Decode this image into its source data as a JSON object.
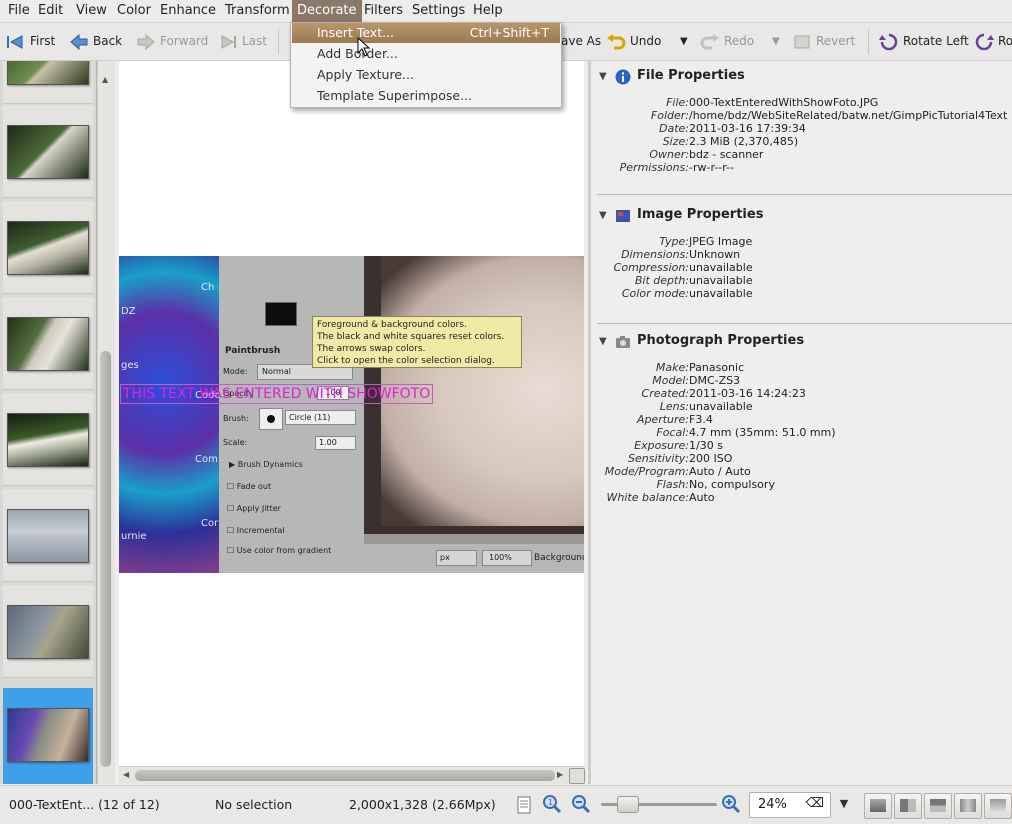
{
  "menubar": {
    "items": [
      "File",
      "Edit",
      "View",
      "Color",
      "Enhance",
      "Transform",
      "Decorate",
      "Filters",
      "Settings",
      "Help"
    ],
    "active": "Decorate"
  },
  "toolbar": {
    "first": "First",
    "back": "Back",
    "forward": "Forward",
    "last": "Last",
    "save_as": "ave As",
    "undo": "Undo",
    "redo": "Redo",
    "revert": "Revert",
    "rotate_left": "Rotate Left",
    "rotate_right": "Ro"
  },
  "decorate_menu": {
    "items": [
      {
        "label": "Insert Text...",
        "shortcut": "Ctrl+Shift+T"
      },
      {
        "label": "Add Border...",
        "shortcut": ""
      },
      {
        "label": "Apply Texture...",
        "shortcut": ""
      },
      {
        "label": "Template Superimpose...",
        "shortcut": ""
      }
    ]
  },
  "thumbnails": {
    "count": 8,
    "selected_index": 7
  },
  "photo": {
    "overlay_text": "THIS TEXT WAS ENTERED WITH SHOWFOTO",
    "tooltip_lines": [
      "Foreground & background colors.",
      "The black and white squares reset colors.",
      "The arrows swap colors.",
      "Click to open the color selection dialog."
    ],
    "panel_title": "Paintbrush",
    "mode_label": "Mode:",
    "mode_value": "Normal",
    "opacity_label": "Opacity",
    "opacity_value": "100",
    "brush_label": "Brush:",
    "brush_value": "Circle (11)",
    "scale_label": "Scale:",
    "scale_value": "1.00",
    "brush_dynamics": "Brush Dynamics",
    "fade_out": "Fade out",
    "apply_jitter": "Apply Jitter",
    "incremental": "Incremental",
    "use_color": "Use color from gradient",
    "unit": "px",
    "zoom": "100%",
    "background": "Background",
    "left_texts": [
      "Ch",
      "DZ",
      "ges",
      "Code",
      "Com",
      "Cor",
      "urnie"
    ]
  },
  "properties": {
    "file": {
      "title": "File Properties",
      "rows": [
        {
          "k": "File:",
          "v": "000-TextEnteredWithShowFoto.JPG"
        },
        {
          "k": "Folder:",
          "v": "/home/bdz/WebSiteRelated/batw.net/GimpPicTutorial4Text"
        },
        {
          "k": "Date:",
          "v": "2011-03-16 17:39:34"
        },
        {
          "k": "Size:",
          "v": "2.3 MiB (2,370,485)"
        },
        {
          "k": "Owner:",
          "v": "bdz - scanner"
        },
        {
          "k": "Permissions:",
          "v": "-rw-r--r--"
        }
      ]
    },
    "image": {
      "title": "Image Properties",
      "rows": [
        {
          "k": "Type:",
          "v": "JPEG Image"
        },
        {
          "k": "Dimensions:",
          "v": "Unknown"
        },
        {
          "k": "Compression:",
          "v": "unavailable"
        },
        {
          "k": "Bit depth:",
          "v": "unavailable"
        },
        {
          "k": "Color mode:",
          "v": "unavailable"
        }
      ]
    },
    "photograph": {
      "title": "Photograph Properties",
      "rows": [
        {
          "k": "Make:",
          "v": "Panasonic"
        },
        {
          "k": "Model:",
          "v": "DMC-ZS3"
        },
        {
          "k": "Created:",
          "v": "2011-03-16 14:24:23"
        },
        {
          "k": "Lens:",
          "v": "unavailable"
        },
        {
          "k": "Aperture:",
          "v": "F3.4"
        },
        {
          "k": "Focal:",
          "v": "4.7 mm (35mm: 51.0 mm)"
        },
        {
          "k": "Exposure:",
          "v": "1/30 s"
        },
        {
          "k": "Sensitivity:",
          "v": "200 ISO"
        },
        {
          "k": "Mode/Program:",
          "v": "Auto / Auto"
        },
        {
          "k": "Flash:",
          "v": "No, compulsory"
        },
        {
          "k": "White balance:",
          "v": "Auto"
        }
      ]
    }
  },
  "status": {
    "filename": "000-TextEnt... (12 of 12)",
    "selection": "No selection",
    "dimensions": "2,000x1,328 (2.66Mpx)",
    "zoom": "24%"
  },
  "colors": {
    "accent": "#8a7969",
    "selection": "#3f9fe8",
    "overlay_text": "#e020e0"
  }
}
